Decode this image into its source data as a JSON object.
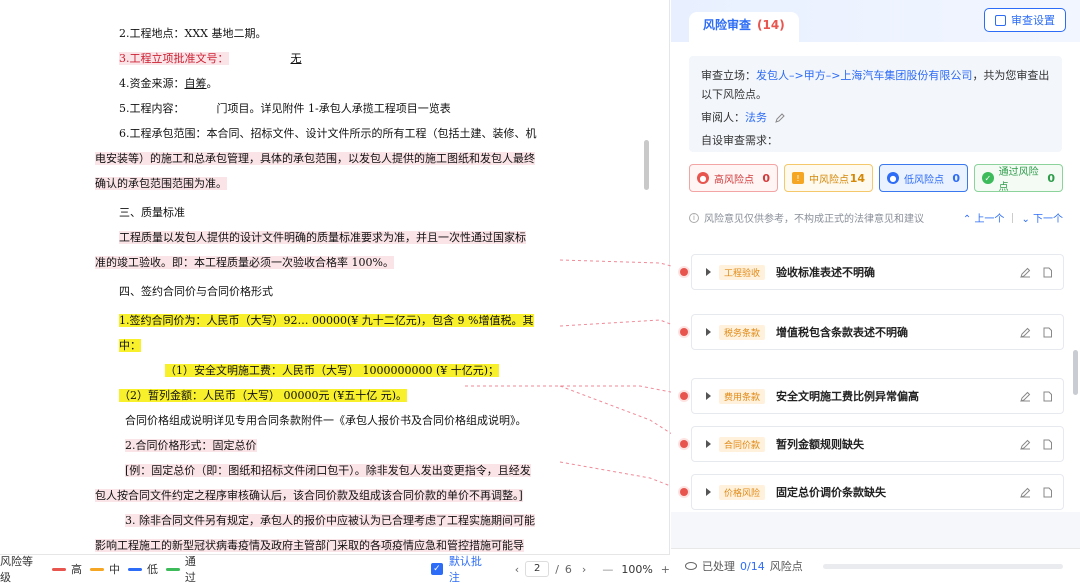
{
  "doc": {
    "lines": [
      {
        "k": "l1",
        "t": "2.工程地点：XXX 基地二期。"
      },
      {
        "k": "l2a",
        "t": "3.工程立项批准文号："
      },
      {
        "k": "l2b",
        "t": "无"
      },
      {
        "k": "l3a",
        "t": "4.资金来源："
      },
      {
        "k": "l3b",
        "t": "自筹"
      },
      {
        "k": "l3c",
        "t": "。"
      },
      {
        "k": "l4a",
        "t": "5.工程内容："
      },
      {
        "k": "l4b",
        "t": "门项目。详见附件 1-承包人承揽工程项目一览表"
      },
      {
        "k": "l5",
        "t": "6.工程承包范围：本合同、招标文件、设计文件所示的所有工程（包括土建、装修、机"
      },
      {
        "k": "l6",
        "t": "电安装等）的施工和总承包管理，具体的承包范围，以发包人提供的施工图纸和发包人最终"
      },
      {
        "k": "l7",
        "t": "确认的承包范围范围为准。"
      },
      {
        "k": "l8",
        "t": "三、质量标准"
      },
      {
        "k": "l9",
        "t": "工程质量以发包人提供的设计文件明确的质量标准要求为准，并且一次性通过国家标"
      },
      {
        "k": "l10",
        "t": "准的竣工验收。即：本工程质量必须一次验收合格率 100%。"
      },
      {
        "k": "l11",
        "t": "四、签约合同价与合同价格形式"
      },
      {
        "k": "l12",
        "t": "1.签约合同价为：人民币（大写）92… 00000(¥ 九十二亿元)，包含 9 %增值税。其"
      },
      {
        "k": "l13",
        "t": "中："
      },
      {
        "k": "l14",
        "t": "（1）安全文明施工费：人民币（大写） 1000000000 (¥ 十亿元)；"
      },
      {
        "k": "l15",
        "t": "（2）暂列金额：人民币（大写） 00000元 (¥五十亿 元)。"
      },
      {
        "k": "l16",
        "t": "合同价格组成说明详见专用合同条款附件一《承包人报价书及合同价格组成说明》。"
      },
      {
        "k": "l17",
        "t": "2.合同价格形式：固定总价"
      },
      {
        "k": "l18",
        "t": "[例：固定总价（即：图纸和招标文件闭口包干）。除非发包人发出变更指令，且经发"
      },
      {
        "k": "l19",
        "t": "包人按合同文件约定之程序审核确认后，该合同价款及组成该合同价款的单价不再调整。]"
      },
      {
        "k": "l20",
        "t": "3. 除非合同文件另有规定，承包人的报价中应被认为已合理考虑了工程实施期间可能"
      },
      {
        "k": "l21",
        "t": "影响工程施工的新型冠状病毒疫情及政府主管部门采取的各项疫情应急和管控措施可能导"
      }
    ]
  },
  "toolbar": {
    "risk_level_label": "风险等级",
    "legend": [
      {
        "label": "高",
        "color": "#e8554f"
      },
      {
        "label": "中",
        "color": "#f5a623"
      },
      {
        "label": "低",
        "color": "#2d6cf6"
      },
      {
        "label": "通过",
        "color": "#3dbb5b"
      }
    ],
    "default_annotation": "默认批注",
    "page_current": "2",
    "page_sep": "/",
    "page_total": "6",
    "zoom_minus": "—",
    "zoom": "100%",
    "zoom_plus": "+"
  },
  "panel": {
    "tab_title": "风险审查",
    "tab_count": "(14)",
    "settings_label": "审查设置",
    "stance_label": "审查立场：",
    "stance_value": "发包人–>甲方–>上海汽车集团股份有限公司",
    "stance_suffix": "，共为您审查出以下风险点。",
    "reviewer_label": "审阅人：",
    "reviewer_value": "法务",
    "custom_label": "自设审查需求：",
    "badges": [
      {
        "label": "高风险点",
        "count": "0"
      },
      {
        "label": "中风险点",
        "count": "14"
      },
      {
        "label": "低风险点",
        "count": "0"
      },
      {
        "label": "通过风险点",
        "count": "0"
      }
    ],
    "disclaimer": "风险意见仅供参考，不构成正式的法律意见和建议",
    "prev": "上一个",
    "next": "下一个",
    "risks": [
      {
        "tag": "工程验收",
        "title": "验收标准表述不明确"
      },
      {
        "tag": "税务条款",
        "title": "增值税包含条款表述不明确"
      },
      {
        "tag": "费用条款",
        "title": "安全文明施工费比例异常偏高"
      },
      {
        "tag": "合同价款",
        "title": "暂列金额规则缺失"
      },
      {
        "tag": "价格风险",
        "title": "固定总价调价条款缺失"
      }
    ],
    "processed_label": "已处理",
    "processed_value": "0/14",
    "processed_suffix": "风险点"
  }
}
